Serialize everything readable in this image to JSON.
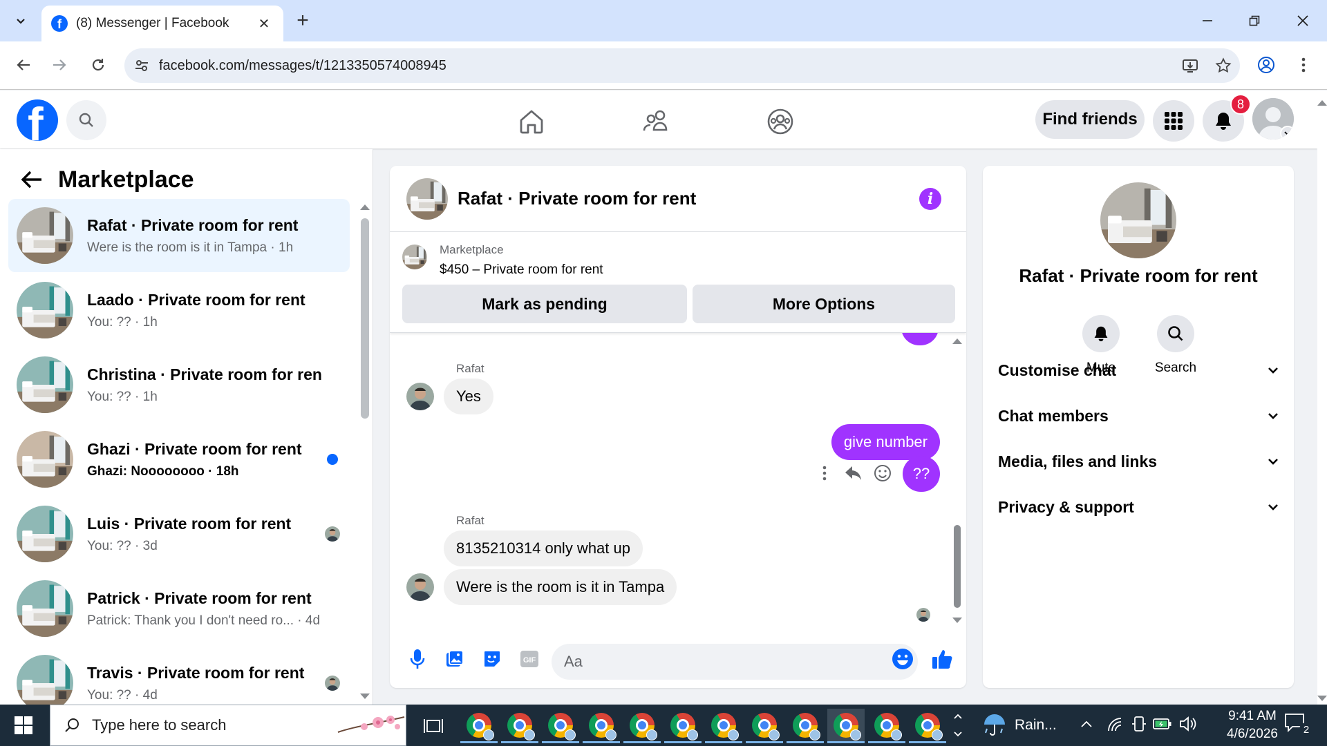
{
  "browser": {
    "tab_title": "(8) Messenger | Facebook",
    "url": "facebook.com/messages/t/1213350574008945"
  },
  "fb_header": {
    "find_friends_label": "Find friends",
    "notification_count": "8"
  },
  "left_panel": {
    "title": "Marketplace",
    "conversations": [
      {
        "name": "Rafat · Private room for rent",
        "preview": "Were is the room is it in Tampa · 1h",
        "active": true,
        "status": "none"
      },
      {
        "name": "Laado · Private room for rent",
        "preview": "You: ?? · 1h",
        "status": "none"
      },
      {
        "name": "Christina · Private room for rent",
        "preview": "You: ?? · 1h",
        "status": "none"
      },
      {
        "name": "Ghazi · Private room for rent",
        "preview": "Ghazi: Noooooooo · 18h",
        "status": "unread"
      },
      {
        "name": "Luis · Private room for rent",
        "preview": "You: ?? · 3d",
        "status": "seen"
      },
      {
        "name": "Patrick · Private room for rent",
        "preview": "Patrick: Thank you I don't need ro...  · 4d",
        "status": "none"
      },
      {
        "name": "Travis · Private room for rent",
        "preview": "You: ?? · 4d",
        "status": "seen"
      }
    ]
  },
  "chat": {
    "title": "Rafat · Private room for rent",
    "listing": {
      "kind": "Marketplace",
      "price_title": "$450 – Private room for rent",
      "mark_pending_label": "Mark as pending",
      "more_options_label": "More Options"
    },
    "messages": [
      {
        "sender": "Rafat",
        "text": "Yes"
      },
      {
        "text": "give number"
      },
      {
        "text": "??"
      },
      {
        "sender": "Rafat",
        "text": "8135210314 only what up"
      },
      {
        "text": "Were is the room is it in Tampa"
      }
    ],
    "composer_placeholder": "Aa"
  },
  "info_panel": {
    "name": "Rafat · Private room for rent",
    "mute_label": "Mute",
    "search_label": "Search",
    "sections": [
      "Customise chat",
      "Chat members",
      "Media, files and links",
      "Privacy & support"
    ]
  },
  "taskbar": {
    "search_placeholder": "Type here to search",
    "weather": "Rain...",
    "time": "9:41 AM",
    "date": "4/6/2026",
    "notification_count": "2"
  }
}
